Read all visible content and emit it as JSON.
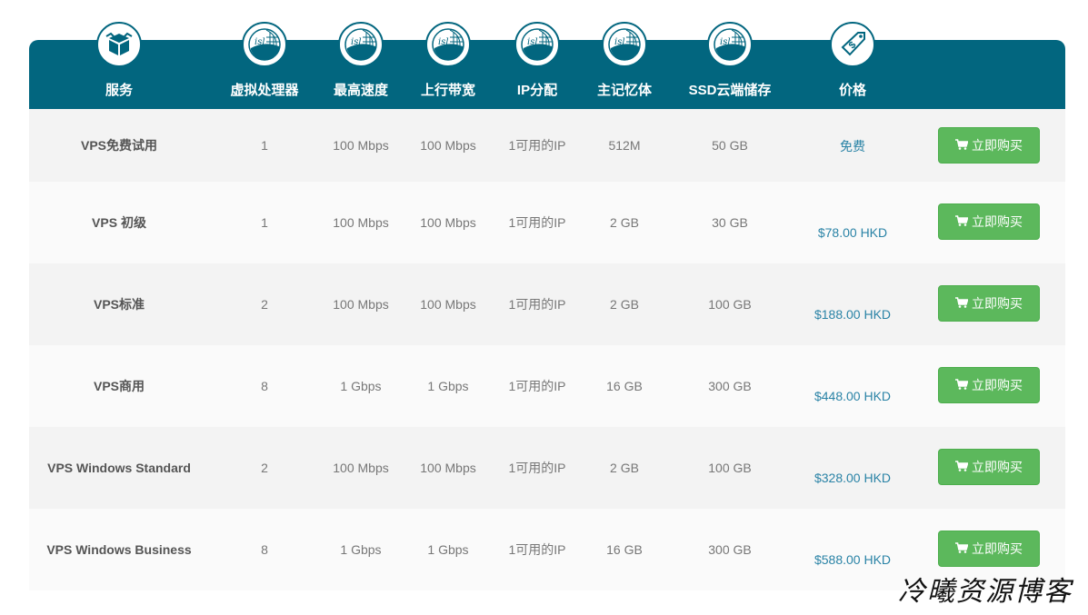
{
  "columns": [
    {
      "label": "服务",
      "icon": "box-icon"
    },
    {
      "label": "虚拟处理器",
      "icon": "isl-globe-icon"
    },
    {
      "label": "最高速度",
      "icon": "isl-globe-icon"
    },
    {
      "label": "上行带宽",
      "icon": "isl-globe-icon"
    },
    {
      "label": "IP分配",
      "icon": "isl-globe-icon"
    },
    {
      "label": "主记忆体",
      "icon": "isl-globe-icon"
    },
    {
      "label": "SSD云端储存",
      "icon": "isl-globe-icon"
    },
    {
      "label": "价格",
      "icon": "price-tag-icon"
    }
  ],
  "icon_text": "isl",
  "buy_label": "立即购买",
  "rows": [
    {
      "name": "VPS免费试用",
      "cpu": "1",
      "speed": "100 Mbps",
      "bandwidth": "100 Mbps",
      "ip": "1可用的IP",
      "ram": "512M",
      "ssd": "50 GB",
      "price": "免费"
    },
    {
      "name": "VPS 初级",
      "cpu": "1",
      "speed": "100 Mbps",
      "bandwidth": "100 Mbps",
      "ip": "1可用的IP",
      "ram": "2 GB",
      "ssd": "30 GB",
      "price": "$78.00 HKD"
    },
    {
      "name": "VPS标准",
      "cpu": "2",
      "speed": "100 Mbps",
      "bandwidth": "100 Mbps",
      "ip": "1可用的IP",
      "ram": "2 GB",
      "ssd": "100 GB",
      "price": "$188.00 HKD"
    },
    {
      "name": "VPS商用",
      "cpu": "8",
      "speed": "1 Gbps",
      "bandwidth": "1 Gbps",
      "ip": "1可用的IP",
      "ram": "16 GB",
      "ssd": "300 GB",
      "price": "$448.00 HKD"
    },
    {
      "name": "VPS Windows Standard",
      "cpu": "2",
      "speed": "100 Mbps",
      "bandwidth": "100 Mbps",
      "ip": "1可用的IP",
      "ram": "2 GB",
      "ssd": "100 GB",
      "price": "$328.00 HKD"
    },
    {
      "name": "VPS Windows Business",
      "cpu": "8",
      "speed": "1 Gbps",
      "bandwidth": "1 Gbps",
      "ip": "1可用的IP",
      "ram": "16 GB",
      "ssd": "300 GB",
      "price": "$588.00 HKD"
    }
  ],
  "watermark": "冷曦资源博客",
  "colors": {
    "header": "#02667f",
    "buy_button": "#5cb85c",
    "price": "#2a83a6"
  }
}
